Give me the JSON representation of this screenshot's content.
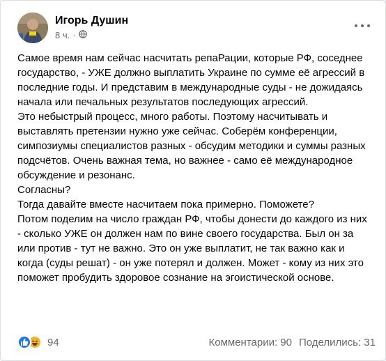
{
  "post": {
    "author": "Игорь Душин",
    "time": "8 ч.",
    "separator": "·",
    "privacy_icon": "globe-icon",
    "more_icon": "more-horizontal-icon",
    "paragraphs": [
      "Самое время нам сейчас насчитать репаРации, которые РФ, соседнее государство, - УЖЕ должно выплатить Украине по сумме её агрессий в последние годы. И представим в международные суды - не дожидаясь начала или печальных результатов последующих агрессий.",
      "Это небыстрый процесс, много работы. Поэтому насчитывать и выставлять претензии нужно уже сейчас. Соберём конференции, симпозиумы специалистов разных - обсудим методики и суммы разных подсчётов. Очень важная тема, но важнее - само её международное обсуждение и резонанс.",
      "Согласны?",
      "Тогда давайте вместе насчитаем пока примерно. Поможете?",
      "Потом поделим на число граждан РФ, чтобы донести до каждого из них - сколько УЖЕ он должен нам по вине своего государства. Был он за или против - тут не важно. Это он уже выплатит, не так важно как и когда (суды решат) - он уже потерял и должен. Может - кому из них это поможет пробудить здоровое сознание на эгоистической основе."
    ]
  },
  "footer": {
    "reaction_icons": [
      "like-icon",
      "haha-icon"
    ],
    "reaction_count": "94",
    "comments": "Комментарии: 90",
    "shares": "Поделились: 31"
  },
  "colors": {
    "like": "#1877f2",
    "haha": "#f7b125",
    "secondary_text": "#65676b"
  }
}
